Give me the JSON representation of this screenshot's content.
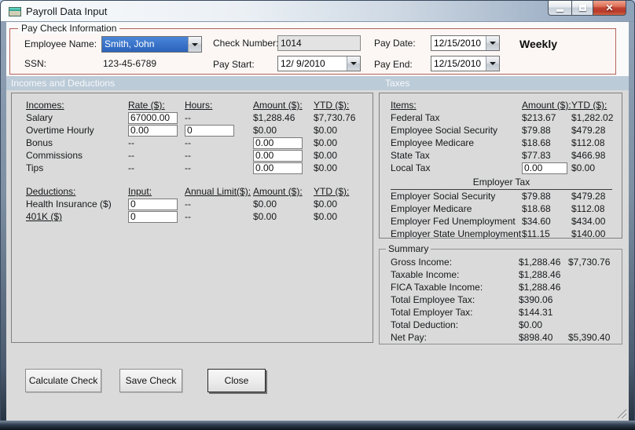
{
  "window": {
    "title": "Payroll Data Input"
  },
  "icons": {
    "close_glyph": "✕"
  },
  "colors": {
    "selection_blue": "#2B63BB",
    "group_border_red": "#B4625A",
    "section_header_bg": "#BCCBD8",
    "close_button_red": "#C04434"
  },
  "paycheck_info": {
    "group_label": "Pay Check Information",
    "employee_name_label": "Employee Name:",
    "employee_name_value": "Smith, John",
    "ssn_label": "SSN:",
    "ssn_value": "123-45-6789",
    "check_number_label": "Check Number:",
    "check_number_value": "1014",
    "pay_start_label": "Pay Start:",
    "pay_start_value": "12/ 9/2010",
    "pay_date_label": "Pay Date:",
    "pay_date_value": "12/15/2010",
    "pay_end_label": "Pay End:",
    "pay_end_value": "12/15/2010",
    "frequency": "Weekly"
  },
  "sections": {
    "incomes_header": "Incomes and Deductions",
    "taxes_header": "Taxes"
  },
  "incomes_table": {
    "headers": [
      "Incomes:",
      "Rate ($):",
      "Hours:",
      "Amount ($):",
      "YTD ($):"
    ],
    "rows": [
      {
        "cells": [
          {
            "t": "text",
            "v": "Salary"
          },
          {
            "t": "input",
            "v": "67000.00"
          },
          {
            "t": "text",
            "v": "--"
          },
          {
            "t": "text",
            "v": "$1,288.46"
          },
          {
            "t": "text",
            "v": "$7,730.76"
          }
        ]
      },
      {
        "cells": [
          {
            "t": "text",
            "v": "Overtime Hourly"
          },
          {
            "t": "input",
            "v": "0.00"
          },
          {
            "t": "input",
            "v": "0"
          },
          {
            "t": "text",
            "v": "$0.00"
          },
          {
            "t": "text",
            "v": "$0.00"
          }
        ]
      },
      {
        "cells": [
          {
            "t": "text",
            "v": "Bonus"
          },
          {
            "t": "text",
            "v": "--"
          },
          {
            "t": "text",
            "v": "--"
          },
          {
            "t": "input",
            "v": "0.00"
          },
          {
            "t": "text",
            "v": "$0.00"
          }
        ]
      },
      {
        "cells": [
          {
            "t": "text",
            "v": "Commissions"
          },
          {
            "t": "text",
            "v": "--"
          },
          {
            "t": "text",
            "v": "--"
          },
          {
            "t": "input",
            "v": "0.00"
          },
          {
            "t": "text",
            "v": "$0.00"
          }
        ]
      },
      {
        "cells": [
          {
            "t": "text",
            "v": "Tips"
          },
          {
            "t": "text",
            "v": "--"
          },
          {
            "t": "text",
            "v": "--"
          },
          {
            "t": "input",
            "v": "0.00"
          },
          {
            "t": "text",
            "v": "$0.00"
          }
        ]
      }
    ]
  },
  "deductions_table": {
    "headers": [
      "Deductions:",
      "Input:",
      "Annual Limit($):",
      "Amount ($):",
      "YTD ($):"
    ],
    "rows": [
      {
        "cells": [
          {
            "t": "text",
            "v": "Health Insurance ($)"
          },
          {
            "t": "input",
            "v": "0"
          },
          {
            "t": "text",
            "v": "--"
          },
          {
            "t": "text",
            "v": "$0.00"
          },
          {
            "t": "text",
            "v": "$0.00"
          }
        ]
      },
      {
        "cells": [
          {
            "t": "link",
            "v": "401K ($)"
          },
          {
            "t": "input",
            "v": "0"
          },
          {
            "t": "text",
            "v": "--"
          },
          {
            "t": "text",
            "v": "$0.00"
          },
          {
            "t": "text",
            "v": "$0.00"
          }
        ]
      }
    ]
  },
  "taxes_table": {
    "headers": [
      "Items:",
      "Amount ($):",
      "YTD ($):"
    ],
    "rows": [
      {
        "cells": [
          {
            "t": "text",
            "v": "Federal Tax"
          },
          {
            "t": "text",
            "v": "$213.67"
          },
          {
            "t": "text",
            "v": "$1,282.02"
          }
        ]
      },
      {
        "cells": [
          {
            "t": "text",
            "v": "Employee Social Security"
          },
          {
            "t": "text",
            "v": "$79.88"
          },
          {
            "t": "text",
            "v": "$479.28"
          }
        ]
      },
      {
        "cells": [
          {
            "t": "text",
            "v": "Employee Medicare"
          },
          {
            "t": "text",
            "v": "$18.68"
          },
          {
            "t": "text",
            "v": "$112.08"
          }
        ]
      },
      {
        "cells": [
          {
            "t": "text",
            "v": "State Tax"
          },
          {
            "t": "text",
            "v": "$77.83"
          },
          {
            "t": "text",
            "v": "$466.98"
          }
        ]
      },
      {
        "cells": [
          {
            "t": "text",
            "v": "Local Tax"
          },
          {
            "t": "input",
            "v": "0.00"
          },
          {
            "t": "text",
            "v": "$0.00"
          }
        ]
      }
    ]
  },
  "employer_tax": {
    "title": "Employer Tax",
    "table": {
      "rows": [
        {
          "cells": [
            {
              "t": "text",
              "v": "Employer Social Security"
            },
            {
              "t": "text",
              "v": "$79.88"
            },
            {
              "t": "text",
              "v": "$479.28"
            }
          ]
        },
        {
          "cells": [
            {
              "t": "text",
              "v": "Employer Medicare"
            },
            {
              "t": "text",
              "v": "$18.68"
            },
            {
              "t": "text",
              "v": "$112.08"
            }
          ]
        },
        {
          "cells": [
            {
              "t": "text",
              "v": "Employer Fed Unemployment"
            },
            {
              "t": "text",
              "v": "$34.60"
            },
            {
              "t": "text",
              "v": "$434.00"
            }
          ]
        },
        {
          "cells": [
            {
              "t": "text",
              "v": "Employer State Unemployment"
            },
            {
              "t": "text",
              "v": "$11.15"
            },
            {
              "t": "text",
              "v": "$140.00"
            }
          ]
        }
      ]
    }
  },
  "summary": {
    "group_label": "Summary",
    "table": {
      "rows": [
        {
          "cells": [
            {
              "t": "text",
              "v": "Gross Income:"
            },
            {
              "t": "text",
              "v": "$1,288.46"
            },
            {
              "t": "text",
              "v": "$7,730.76"
            }
          ]
        },
        {
          "cells": [
            {
              "t": "text",
              "v": "Taxable Income:"
            },
            {
              "t": "text",
              "v": "$1,288.46"
            },
            {
              "t": "text",
              "v": ""
            }
          ]
        },
        {
          "cells": [
            {
              "t": "text",
              "v": "FICA Taxable Income:"
            },
            {
              "t": "text",
              "v": "$1,288.46"
            },
            {
              "t": "text",
              "v": ""
            }
          ]
        },
        {
          "cells": [
            {
              "t": "text",
              "v": "Total Employee Tax:"
            },
            {
              "t": "text",
              "v": "$390.06"
            },
            {
              "t": "text",
              "v": ""
            }
          ]
        },
        {
          "cells": [
            {
              "t": "text",
              "v": "Total Employer Tax:"
            },
            {
              "t": "text",
              "v": "$144.31"
            },
            {
              "t": "text",
              "v": ""
            }
          ]
        },
        {
          "cells": [
            {
              "t": "text",
              "v": "Total Deduction:"
            },
            {
              "t": "text",
              "v": "$0.00"
            },
            {
              "t": "text",
              "v": ""
            }
          ]
        },
        {
          "cells": [
            {
              "t": "text",
              "v": "Net Pay:"
            },
            {
              "t": "text",
              "v": "$898.40"
            },
            {
              "t": "text",
              "v": "$5,390.40"
            }
          ]
        }
      ]
    }
  },
  "buttons": {
    "calculate": "Calculate Check",
    "save": "Save Check",
    "close": "Close"
  }
}
